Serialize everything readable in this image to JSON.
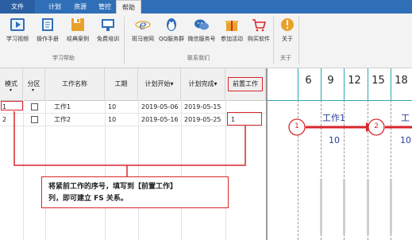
{
  "tabs": [
    {
      "label": "文件",
      "active": false
    },
    {
      "label": "计划",
      "active": false
    },
    {
      "label": "资源",
      "active": false
    },
    {
      "label": "管控",
      "active": false
    },
    {
      "label": "帮助",
      "active": true
    }
  ],
  "ribbon": {
    "buttons": [
      {
        "label": "学习视频",
        "icon": "play-video-icon"
      },
      {
        "label": "操作手册",
        "icon": "manual-book-icon"
      },
      {
        "label": "经典案例",
        "icon": "case-folder-icon"
      },
      {
        "label": "免费培训",
        "icon": "training-icon"
      },
      {
        "label": "斑马官网",
        "icon": "browser-ie-icon"
      },
      {
        "label": "QQ服务群",
        "icon": "qq-penguin-icon"
      },
      {
        "label": "微信服务号",
        "icon": "wechat-icon"
      },
      {
        "label": "参加活动",
        "icon": "gift-icon"
      },
      {
        "label": "购买软件",
        "icon": "shopping-cart-icon"
      },
      {
        "label": "关于",
        "icon": "info-icon"
      }
    ],
    "groups": [
      "学习帮助",
      "联系我们",
      "关于"
    ]
  },
  "grid": {
    "headers": [
      "模式",
      "分区",
      "工作名称",
      "工期",
      "计划开始",
      "计划完成",
      "前置工作"
    ],
    "rows": [
      {
        "id": "1",
        "name": "工作1",
        "duration": "10",
        "start": "2019-05-06",
        "end": "2019-05-15",
        "pred": ""
      },
      {
        "id": "2",
        "name": "工作2",
        "duration": "10",
        "start": "2019-05-16",
        "end": "2019-05-25",
        "pred": "1"
      }
    ]
  },
  "gantt": {
    "days": [
      "6",
      "9",
      "12",
      "15",
      "18"
    ],
    "nodes": [
      {
        "label": "1"
      },
      {
        "label": "2"
      }
    ],
    "tasks": [
      {
        "name": "工作1",
        "duration": "10"
      },
      {
        "name": "工",
        "duration": "10"
      }
    ]
  },
  "callout": {
    "line1": "将紧前工作的序号，填写到【前置工作】",
    "line2": "列，即可建立 FS 关系。"
  },
  "colors": {
    "accent": "#2f6fb7",
    "highlight": "#d8262b",
    "teal": "#2aa7b5",
    "task_text": "#2c3c9a"
  }
}
